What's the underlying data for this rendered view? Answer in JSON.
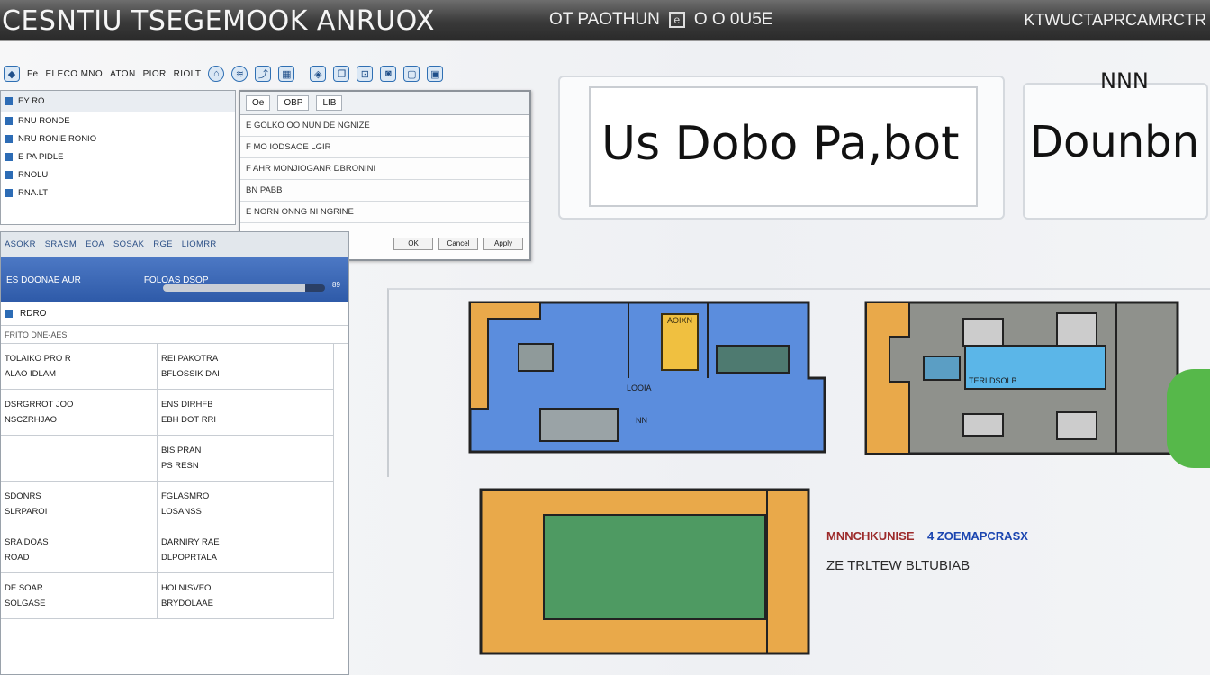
{
  "window": {
    "title": "CESNTIU TSEGEMOOK ANRUOX",
    "controls_text": "OT PAOTHUN",
    "controls_mid": "O  O 0U5E",
    "right_text": "KTWUCTAPRCAMRCTR"
  },
  "toolbar": {
    "items": [
      "Fe",
      "ELECO MNO",
      "ATON",
      "PIOR",
      "RIOLT"
    ]
  },
  "left_panel": {
    "header": "EY  RO",
    "rows": [
      "RNU  RONDE",
      "NRU RONIE  RONIO ",
      "E PA  PIDLE",
      "RNOLU",
      "RNA.LT"
    ]
  },
  "prop_window": {
    "tabs": [
      "Oe",
      "OBP",
      "LIB"
    ],
    "rows": [
      "E GOLKO OO NUN DE NGNIZE",
      "F MO IODSAOE LGIR",
      "F AHR MONJIOGANR  DBRONINI",
      "BN PABB",
      "E NORN ONNG NI NGRINE"
    ],
    "buttons": [
      "OK",
      "Cancel",
      "Apply"
    ]
  },
  "file_panel": {
    "tabs": [
      "ASOKR",
      "SRASM",
      "EOA",
      "SOSAK",
      "RGE",
      "LIOMRR"
    ],
    "banner_left": "ES DOONAE AUR",
    "banner_right": "FOLOAS DSOP",
    "progress_percent": 88,
    "progress_label": "89",
    "sub_label": "RDRO",
    "filter": "FRITO DNE-AES",
    "cells": [
      [
        "TOLAIKO PRO R",
        "ALAO IDLAM",
        "REI PAKOTRA",
        "BFLOSSIK DAI"
      ],
      [
        "DSRGRROT JOO",
        "NSCZRHJAO",
        "ENS DIRHFB",
        "EBH DOT RRI"
      ],
      [
        "",
        "",
        "BIS PRAN",
        "PS RESN"
      ],
      [
        "SDONRS",
        "SLRPAROI",
        "FGLASMRO",
        "LOSANSS"
      ],
      [
        "SRA DOAS",
        "ROAD",
        "DARNIRY RAE",
        "DLPOPRTALA"
      ],
      [
        "DE SOAR",
        "SOLGASE",
        "HOLNISVEO",
        "BRYDOLAAE"
      ]
    ]
  },
  "previews": {
    "main_text": "Us Dobo Pa,bot",
    "side_text": "Dounbn",
    "side_label": "NNN"
  },
  "canvas": {
    "legend_red": "MNNCHKUNISE",
    "legend_blue": "4 ZOEMAPCRASX",
    "legend_sub": "ZE TRLTEW BLTUBIAB",
    "board1_labels": [
      "AOIXN",
      "LOOIA",
      "NN"
    ],
    "board2_labels": [
      "TERLDSOLB"
    ],
    "colors": {
      "blue_board": "#5b8ddd",
      "gray_board": "#8f918c",
      "orange": "#e9a94a",
      "green": "#4e9a62",
      "cyan": "#5bb6e8"
    }
  }
}
